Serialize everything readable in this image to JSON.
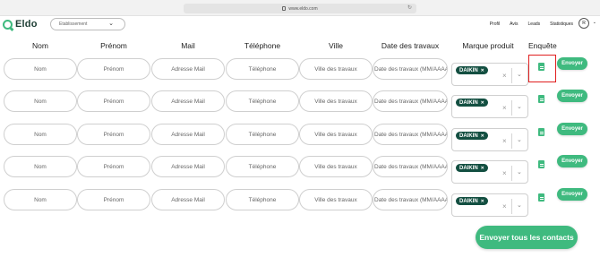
{
  "browser": {
    "url": "www.eldo.com"
  },
  "header": {
    "logo_text": "Eldo",
    "establishment_placeholder": "Etablissement",
    "nav": [
      "Profil",
      "Avis",
      "Leads",
      "Statistiques"
    ],
    "avatar_initial": "R"
  },
  "table": {
    "headers": [
      "Nom",
      "Prénom",
      "Mail",
      "Téléphone",
      "Ville",
      "Date des travaux",
      "Marque produit",
      "Enquête"
    ],
    "placeholders": {
      "nom": "Nom",
      "prenom": "Prénom",
      "mail": "Adresse Mail",
      "telephone": "Téléphone",
      "ville": "Ville des travaux",
      "date": "Date des travaux (MM/AAAA)"
    },
    "rows": [
      {
        "brand_tag": "DAIKIN",
        "send_label": "Envoyer"
      },
      {
        "brand_tag": "DAIKIN",
        "send_label": "Envoyer"
      },
      {
        "brand_tag": "DAIKIN",
        "send_label": "Envoyer"
      },
      {
        "brand_tag": "DAIKIN",
        "send_label": "Envoyer"
      },
      {
        "brand_tag": "DAIKIN",
        "send_label": "Envoyer"
      }
    ]
  },
  "footer": {
    "send_all_label": "Envoyer tous les contacts"
  },
  "colors": {
    "accent": "#3fba7f",
    "tag": "#134f41",
    "highlight": "#e01e1e"
  }
}
